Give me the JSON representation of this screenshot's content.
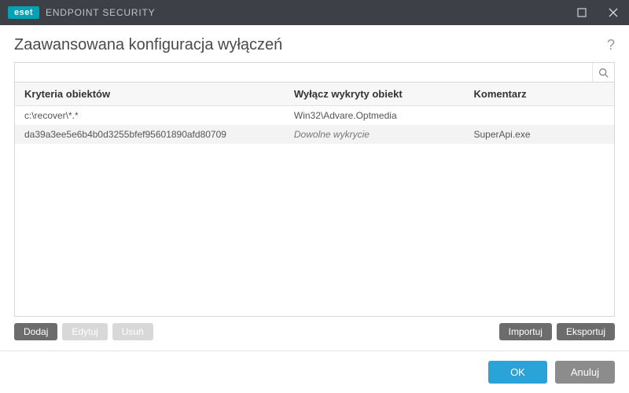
{
  "window": {
    "brand_badge": "eset",
    "brand_text": "ENDPOINT SECURITY"
  },
  "header": {
    "title": "Zaawansowana konfiguracja wyłączeń"
  },
  "search": {
    "placeholder": ""
  },
  "table": {
    "headers": {
      "criteria": "Kryteria obiektów",
      "disable": "Wyłącz wykryty obiekt",
      "comment": "Komentarz"
    },
    "rows": [
      {
        "criteria": "c:\\recover\\*.*",
        "disable": "Win32\\Advare.Optmedia",
        "disable_italic": false,
        "comment": ""
      },
      {
        "criteria": "da39a3ee5e6b4b0d3255bfef95601890afd80709",
        "disable": "Dowolne wykrycie",
        "disable_italic": true,
        "comment": "SuperApi.exe"
      }
    ]
  },
  "actions": {
    "add": "Dodaj",
    "edit": "Edytuj",
    "delete": "Usuń",
    "import": "Importuj",
    "export": "Eksportuj"
  },
  "footer": {
    "ok": "OK",
    "cancel": "Anuluj"
  }
}
